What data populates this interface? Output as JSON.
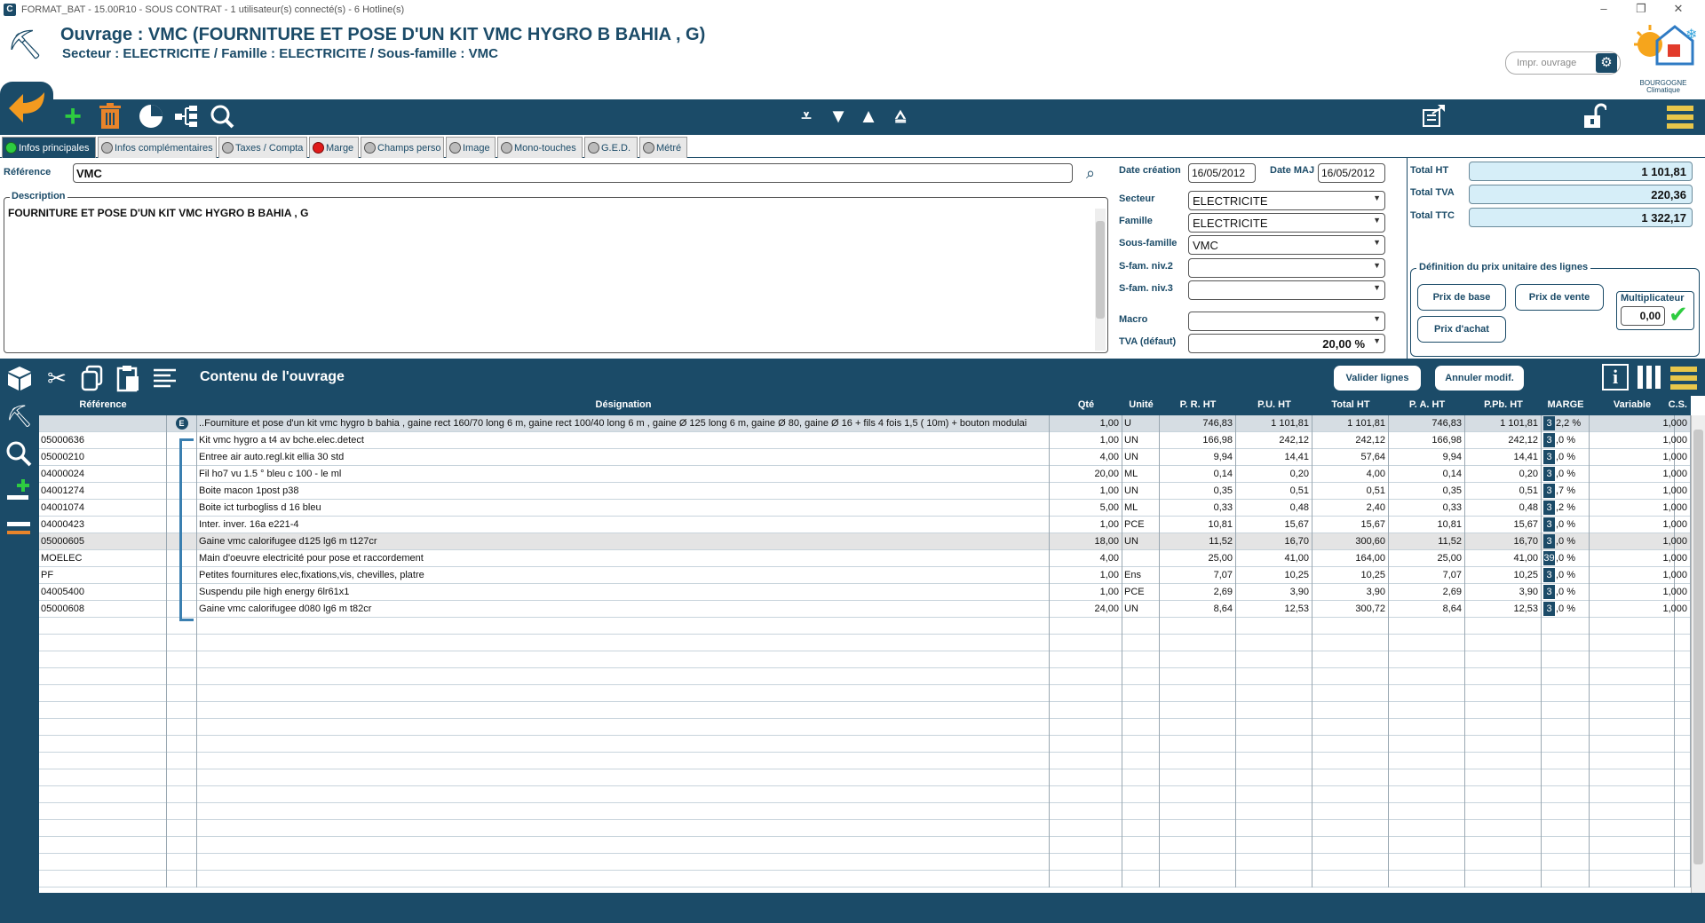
{
  "window": {
    "title": "FORMAT_BAT - 15.00R10 - SOUS CONTRAT - 1 utilisateur(s) connecté(s) - 6 Hotline(s)",
    "minimize": "–",
    "restore": "❐",
    "close": "✕"
  },
  "header": {
    "title": "Ouvrage : VMC (FOURNITURE ET POSE D'UN KIT  VMC HYGRO B BAHIA , G)",
    "subtitle": "Secteur : ELECTRICITE / Famille : ELECTRICITE / Sous-famille : VMC",
    "print_placeholder": "Impr. ouvrage",
    "logo_text": "BOURGOGNE Climatique"
  },
  "tabs": [
    {
      "label": "Infos principales",
      "status": "green"
    },
    {
      "label": "Infos complémentaires",
      "status": "grey"
    },
    {
      "label": "Taxes / Compta",
      "status": "grey"
    },
    {
      "label": "Marge",
      "status": "red"
    },
    {
      "label": "Champs perso",
      "status": "grey"
    },
    {
      "label": "Image",
      "status": "grey"
    },
    {
      "label": "Mono-touches",
      "status": "grey"
    },
    {
      "label": "G.E.D.",
      "status": "grey"
    },
    {
      "label": "Métré",
      "status": "grey"
    }
  ],
  "form": {
    "reference_label": "Référence",
    "reference_value": "VMC",
    "description_label": "Description",
    "description_value": "FOURNITURE ET POSE D'UN KIT  VMC HYGRO B BAHIA , G",
    "date_creation_label": "Date création",
    "date_creation": "16/05/2012",
    "date_maj_label": "Date MAJ",
    "date_maj": "16/05/2012",
    "secteur_label": "Secteur",
    "secteur": "ELECTRICITE",
    "famille_label": "Famille",
    "famille": "ELECTRICITE",
    "sous_famille_label": "Sous-famille",
    "sous_famille": "VMC",
    "sfam2_label": "S-fam. niv.2",
    "sfam2": "",
    "sfam3_label": "S-fam. niv.3",
    "sfam3": "",
    "macro_label": "Macro",
    "macro": "",
    "tva_label": "TVA (défaut)",
    "tva": "20,00 %"
  },
  "totals": {
    "ht_label": "Total HT",
    "ht": "1 101,81",
    "tva_label": "Total TVA",
    "tva": "220,36",
    "ttc_label": "Total TTC",
    "ttc": "1 322,17"
  },
  "pricing": {
    "legend": "Définition du prix unitaire des lignes",
    "prix_base": "Prix de base",
    "prix_vente": "Prix de vente",
    "prix_achat": "Prix d'achat",
    "multiplicateur_label": "Multiplicateur",
    "multiplicateur": "0,00"
  },
  "section": {
    "title": "Contenu de l'ouvrage",
    "valider": "Valider lignes",
    "annuler": "Annuler modif."
  },
  "grid": {
    "headers": [
      "Référence",
      "Désignation",
      "Qté",
      "Unité",
      "P. R. HT",
      "P.U. HT",
      "Total HT",
      "P. A. HT",
      "P.Pb. HT",
      "MARGE",
      "Variable",
      "C.S."
    ],
    "parent_row": {
      "ref": "",
      "designation": "..Fourniture et pose d'un kit  vmc hygro b bahia , gaine rect 160/70 long 6 m, gaine rect 100/40 long 6 m , gaine Ø 125 long 6 m, gaine Ø 80, gaine Ø 16 + fils 4 fois 1,5 ( 10m) + bouton modulai",
      "qte": "1,00",
      "unite": "U",
      "pr": "746,83",
      "pu": "1 101,81",
      "total": "1 101,81",
      "pa": "746,83",
      "ppb": "1 101,81",
      "marge_box": "3",
      "marge": "2,2 %",
      "variable": "",
      "cs": "1,000"
    },
    "rows": [
      {
        "ref": "05000636",
        "designation": "Kit vmc hygro a t4 av bche.elec.detect",
        "qte": "1,00",
        "unite": "UN",
        "pr": "166,98",
        "pu": "242,12",
        "total": "242,12",
        "pa": "166,98",
        "ppb": "242,12",
        "marge_box": "3",
        "marge": ",0 %",
        "cs": "1,000"
      },
      {
        "ref": "05000210",
        "designation": "Entree air auto.regl.kit ellia 30 std",
        "qte": "4,00",
        "unite": "UN",
        "pr": "9,94",
        "pu": "14,41",
        "total": "57,64",
        "pa": "9,94",
        "ppb": "14,41",
        "marge_box": "3",
        "marge": ",0 %",
        "cs": "1,000"
      },
      {
        "ref": "04000024",
        "designation": "Fil ho7 vu 1.5 ° bleu c 100 - le ml",
        "qte": "20,00",
        "unite": "ML",
        "pr": "0,14",
        "pu": "0,20",
        "total": "4,00",
        "pa": "0,14",
        "ppb": "0,20",
        "marge_box": "3",
        "marge": ",0 %",
        "cs": "1,000"
      },
      {
        "ref": "04001274",
        "designation": "Boite macon 1post p38",
        "qte": "1,00",
        "unite": "UN",
        "pr": "0,35",
        "pu": "0,51",
        "total": "0,51",
        "pa": "0,35",
        "ppb": "0,51",
        "marge_box": "3",
        "marge": ",7 %",
        "cs": "1,000"
      },
      {
        "ref": "04001074",
        "designation": "Boite ict turbogliss d 16 bleu",
        "qte": "5,00",
        "unite": "ML",
        "pr": "0,33",
        "pu": "0,48",
        "total": "2,40",
        "pa": "0,33",
        "ppb": "0,48",
        "marge_box": "3",
        "marge": ",2 %",
        "cs": "1,000"
      },
      {
        "ref": "04000423",
        "designation": "Inter. inver. 16a e221-4",
        "qte": "1,00",
        "unite": "PCE",
        "pr": "10,81",
        "pu": "15,67",
        "total": "15,67",
        "pa": "10,81",
        "ppb": "15,67",
        "marge_box": "3",
        "marge": ",0 %",
        "cs": "1,000"
      },
      {
        "ref": "05000605",
        "designation": "Gaine vmc calorifugee d125 lg6 m t127cr",
        "qte": "18,00",
        "unite": "UN",
        "pr": "11,52",
        "pu": "16,70",
        "total": "300,60",
        "pa": "11,52",
        "ppb": "16,70",
        "marge_box": "3",
        "marge": ",0 %",
        "cs": "1,000"
      },
      {
        "ref": "MOELEC",
        "designation": "Main d'oeuvre electricité pour pose et raccordement",
        "qte": "4,00",
        "unite": "",
        "pr": "25,00",
        "pu": "41,00",
        "total": "164,00",
        "pa": "25,00",
        "ppb": "41,00",
        "marge_box": "39",
        "marge": ",0 %",
        "cs": "1,000"
      },
      {
        "ref": "PF",
        "designation": "Petites fournitures elec,fixations,vis, chevilles, platre",
        "qte": "1,00",
        "unite": "Ens",
        "pr": "7,07",
        "pu": "10,25",
        "total": "10,25",
        "pa": "7,07",
        "ppb": "10,25",
        "marge_box": "3",
        "marge": ",0 %",
        "cs": "1,000"
      },
      {
        "ref": "04005400",
        "designation": "Suspendu pile high energy 6lr61x1",
        "qte": "1,00",
        "unite": "PCE",
        "pr": "2,69",
        "pu": "3,90",
        "total": "3,90",
        "pa": "2,69",
        "ppb": "3,90",
        "marge_box": "3",
        "marge": ",0 %",
        "cs": "1,000"
      },
      {
        "ref": "05000608",
        "designation": "Gaine vmc calorifugee d080 lg6 m t82cr",
        "qte": "24,00",
        "unite": "UN",
        "pr": "8,64",
        "pu": "12,53",
        "total": "300,72",
        "pa": "8,64",
        "ppb": "12,53",
        "marge_box": "3",
        "marge": ",0 %",
        "cs": "1,000"
      }
    ]
  },
  "colors": {
    "primary": "#1b4b68",
    "accent": "#f39a1f",
    "add_green": "#2ecc40",
    "delete_orange": "#e8842a",
    "highlight_row": "#d6dde3"
  }
}
